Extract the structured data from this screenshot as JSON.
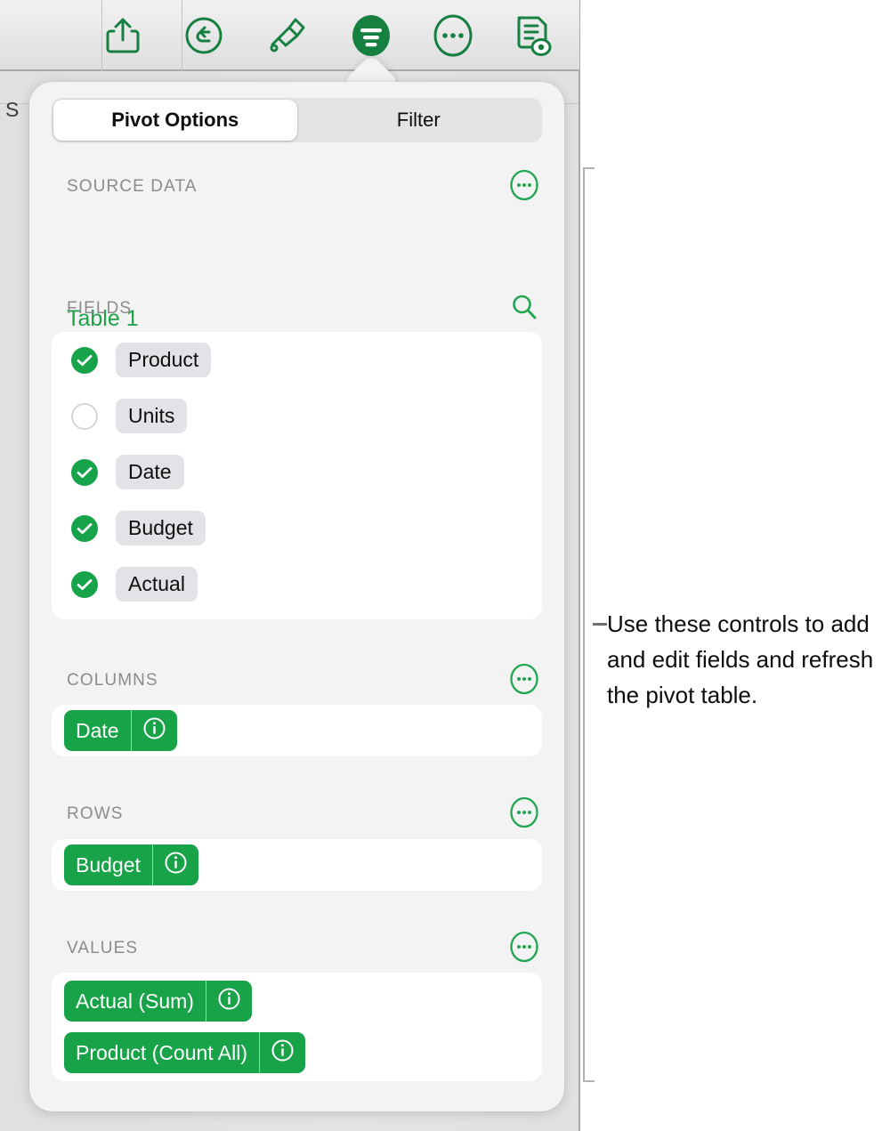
{
  "toolbar": {
    "buttons": [
      {
        "name": "share-icon",
        "label": "Share"
      },
      {
        "name": "undo-icon",
        "label": "Undo"
      },
      {
        "name": "format-brush-icon",
        "label": "Format"
      },
      {
        "name": "pivot-filter-icon",
        "label": "Pivot Options",
        "selected": true
      },
      {
        "name": "more-options-icon",
        "label": "More"
      },
      {
        "name": "document-view-icon",
        "label": "Document Options"
      }
    ]
  },
  "background": {
    "partial_sheet_text": "S"
  },
  "popover": {
    "tabs": [
      {
        "label": "Pivot Options",
        "selected": true
      },
      {
        "label": "Filter",
        "selected": false
      }
    ],
    "source_data": {
      "title": "SOURCE DATA",
      "value": "Table 1",
      "more_icon": "more-options-icon"
    },
    "fields": {
      "title": "FIELDS",
      "search_icon": "search-icon",
      "items": [
        {
          "label": "Product",
          "checked": true
        },
        {
          "label": "Units",
          "checked": false
        },
        {
          "label": "Date",
          "checked": true
        },
        {
          "label": "Budget",
          "checked": true
        },
        {
          "label": "Actual",
          "checked": true
        }
      ]
    },
    "columns": {
      "title": "COLUMNS",
      "more_icon": "more-options-icon",
      "tokens": [
        {
          "label": "Date",
          "info_icon": "info-icon"
        }
      ]
    },
    "rows": {
      "title": "ROWS",
      "more_icon": "more-options-icon",
      "tokens": [
        {
          "label": "Budget",
          "info_icon": "info-icon"
        }
      ]
    },
    "values": {
      "title": "VALUES",
      "more_icon": "more-options-icon",
      "tokens": [
        {
          "label": "Actual (Sum)",
          "info_icon": "info-icon"
        },
        {
          "label": "Product (Count All)",
          "info_icon": "info-icon"
        }
      ]
    }
  },
  "callout": {
    "text": "Use these controls to add and edit fields and refresh the pivot table."
  },
  "colors": {
    "accent_green": "#18a349",
    "link_green": "#1fa04a",
    "popover_bg": "#f3f3f3",
    "card_bg": "#ffffff",
    "pill_gray": "#e2e2e7",
    "section_label": "#8b8b90"
  }
}
